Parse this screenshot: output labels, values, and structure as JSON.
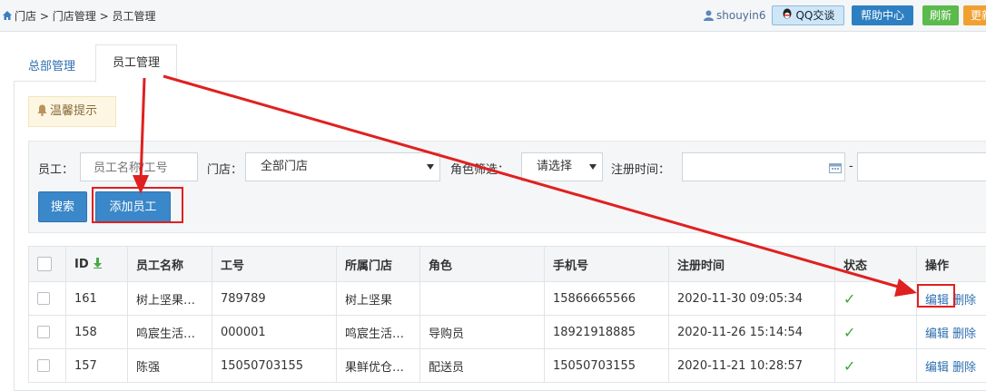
{
  "breadcrumb": {
    "home": "门店",
    "sep1": ">",
    "level2": "门店管理",
    "sep2": ">",
    "level3": "员工管理"
  },
  "header": {
    "username": "shouyin6",
    "qq_label": "QQ交谈",
    "help_label": "帮助中心",
    "refresh_label": "刷新",
    "update_label": "更新"
  },
  "tabs": [
    {
      "label": "总部管理"
    },
    {
      "label": "员工管理"
    }
  ],
  "tip": {
    "label": "温馨提示"
  },
  "filter": {
    "employee_label": "员工：",
    "employee_placeholder": "员工名称/工号",
    "store_label": "门店：",
    "store_value": "全部门店",
    "role_label": "角色筛选：",
    "role_value": "请选择",
    "reg_time_label": "注册时间：",
    "date_sep": "-",
    "search_label": "搜索",
    "add_label": "添加员工"
  },
  "table": {
    "columns": [
      "ID",
      "员工名称",
      "工号",
      "所属门店",
      "角色",
      "手机号",
      "注册时间",
      "状态",
      "操作"
    ],
    "rows": [
      {
        "id": "161",
        "name": "树上坚果…",
        "code": "789789",
        "store": "树上坚果",
        "role": "",
        "phone": "15866665566",
        "time": "2020-11-30 09:05:34",
        "status": "✓",
        "edit": "编辑",
        "delete": "删除"
      },
      {
        "id": "158",
        "name": "鸣宸生活…",
        "code": "000001",
        "store": "鸣宸生活…",
        "role": "导购员",
        "phone": "18921918885",
        "time": "2020-11-26 15:14:54",
        "status": "✓",
        "edit": "编辑",
        "delete": "删除"
      },
      {
        "id": "157",
        "name": "陈强",
        "code": "15050703155",
        "store": "果鲜优仓…",
        "role": "配送员",
        "phone": "15050703155",
        "time": "2020-11-21 10:28:57",
        "status": "✓",
        "edit": "编辑",
        "delete": "删除"
      }
    ]
  },
  "colors": {
    "link": "#2e6fb0",
    "primary_button": "#3a87c9",
    "annotation": "#e02020",
    "status_ok": "#3aa83a"
  },
  "icons": [
    "home-icon",
    "user-icon",
    "qq-icon",
    "bell-icon",
    "calendar-icon",
    "sort-down-icon",
    "check-icon"
  ]
}
